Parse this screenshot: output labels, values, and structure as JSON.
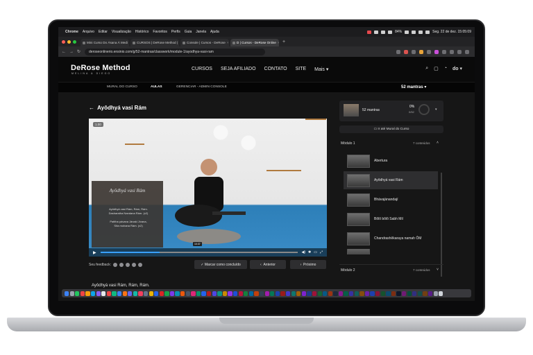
{
  "menubar": {
    "app": "Chrome",
    "items": [
      "Arquivo",
      "Editar",
      "Visualização",
      "Histórico",
      "Favoritos",
      "Perfis",
      "Guia",
      "Janela",
      "Ajuda"
    ],
    "battery": "84%",
    "clock": "Seg. 22 de dez. 15:05:09"
  },
  "browser": {
    "tabs": [
      {
        "label": "Mini Curso Do Ásana Á Medi",
        "active": false
      },
      {
        "label": "CURSOS | DeRose Method |",
        "active": false
      },
      {
        "label": "Console | Cursos - DeRose",
        "active": false
      },
      {
        "label": "D | Cursos - DeRose Online",
        "active": true
      }
    ],
    "url": "deroseonlinerio.ensinio.com/g/52-mantras/classwork/module-1/ayodhya-vasi-ram"
  },
  "site": {
    "logo": "DeRose Method",
    "logo_sub": "MELINA & DIEGO",
    "nav": [
      "CURSOS",
      "SEJA AFILIADO",
      "CONTATO",
      "SITE",
      "Mais"
    ],
    "user_initials": "do"
  },
  "subnav": {
    "items": [
      "MURAL DO CURSO",
      "AULAS",
      "GERENCIAR - ADMIN CONSOLE"
    ],
    "course_select": "52 mantras"
  },
  "lesson": {
    "title": "Ayôdhyá vasi Rám",
    "speed_badge": "1.00",
    "overlay_title": "Ayôdhyá vasi Rám",
    "overlay_line1": "Ayôdhyá vasi Rám, Rám, Rám.",
    "overlay_line2": "Dasharatha Nandana Rám. (x2)",
    "overlay_line3": "Patitha pávana Jánaki Jívana,",
    "overlay_line4": "Síta mohana Rám. (x2)",
    "time_tooltip": "10:37",
    "progress": 0.3,
    "feedback_label": "Seu feedback:",
    "btn_complete": "Marcar como concluído",
    "btn_prev": "Anterior",
    "btn_next": "Próximo",
    "lyrics_preview": "Ayôdhyá vasi Rám, Rám, Rám."
  },
  "sidebar": {
    "course_name": "52 mantras",
    "course_progress": "0%",
    "course_count": "0/52",
    "mural_btn": "Ir até Mural do Curso",
    "module1": "Módulo 1",
    "module1_count": "7 conteúdos",
    "lessons": [
      "Abertura",
      "Ayôdhyá vasi Rám",
      "Bhávajánandají",
      "Bôlô bôlô Sabh Mil",
      "Chandrashêkaraya namah ÔM"
    ],
    "module2": "Módulo 2",
    "module2_count": "7 conteúdos"
  },
  "colors": {
    "accent": "#3aa0ff",
    "bg": "#161616"
  }
}
